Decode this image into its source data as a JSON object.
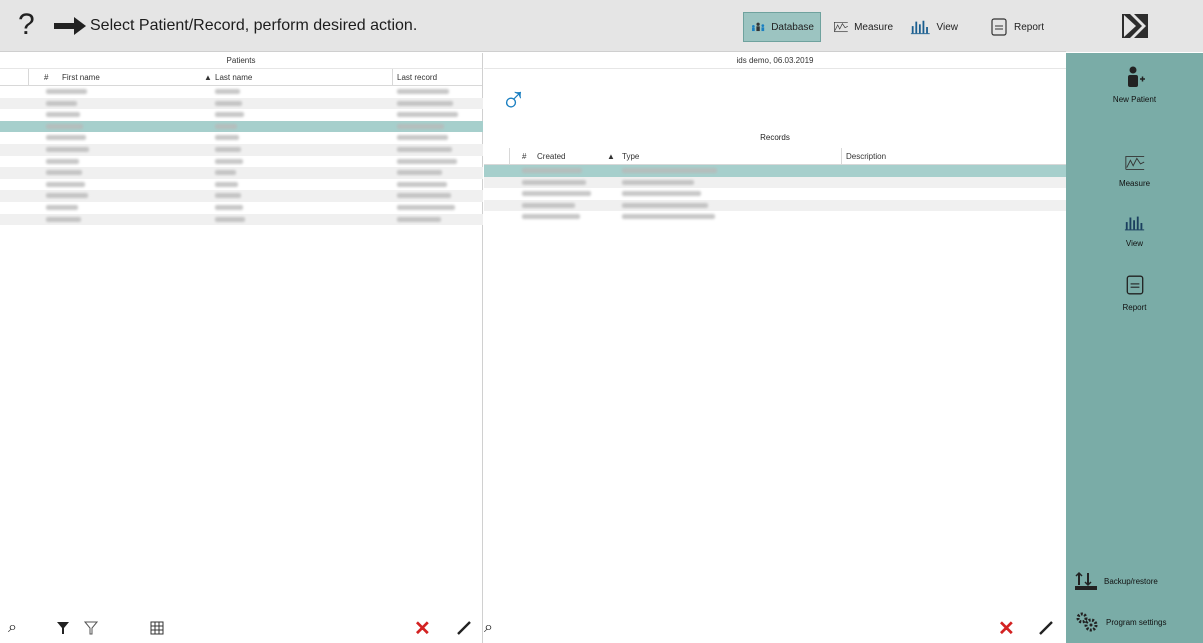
{
  "header": {
    "help_symbol": "?",
    "instruction": "Select Patient/Record, perform desired action.",
    "buttons": {
      "database": "Database",
      "measure": "Measure",
      "view": "View",
      "report": "Report"
    }
  },
  "patients": {
    "title": "Patients",
    "columns": {
      "num": "#",
      "first_name": "First name",
      "last_name": "Last name",
      "last_record": "Last record"
    },
    "row_count": 12,
    "selected_row": 4
  },
  "records_panel": {
    "patient_header": "ids demo, 06.03.2019",
    "gender_symbol": "♂",
    "records_title": "Records",
    "columns": {
      "num": "#",
      "created": "Created",
      "type": "Type",
      "description": "Description"
    },
    "row_count": 5,
    "selected_row": 1
  },
  "sidebar": {
    "new_patient": "New Patient",
    "measure": "Measure",
    "view": "View",
    "report": "Report",
    "backup": "Backup/restore",
    "settings": "Program settings"
  },
  "colors": {
    "accent": "#7aaca7",
    "selection": "#a6cfcc",
    "delete": "#d32222",
    "icon_blue": "#1a7fc1"
  }
}
